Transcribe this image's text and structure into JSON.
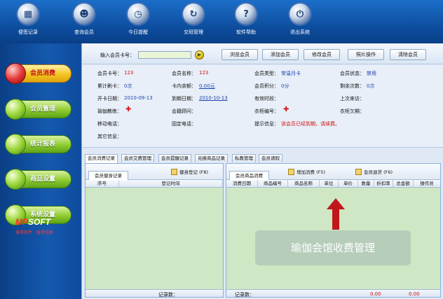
{
  "toolbar": {
    "items": [
      {
        "label": "便签记录",
        "icon": "notepad-icon"
      },
      {
        "label": "查询会员",
        "icon": "member-search-icon"
      },
      {
        "label": "今日提醒",
        "icon": "clock-icon"
      },
      {
        "label": "交班管理",
        "icon": "refresh-icon"
      },
      {
        "label": "软件帮助",
        "icon": "help-icon"
      },
      {
        "label": "退出系统",
        "icon": "power-icon"
      }
    ]
  },
  "nav": {
    "items": [
      {
        "label": "会员消费",
        "active": true
      },
      {
        "label": "会员管理",
        "active": false
      },
      {
        "label": "统计报表",
        "active": false
      },
      {
        "label": "商品设置",
        "active": false
      },
      {
        "label": "系统设置",
        "active": false
      }
    ]
  },
  "logo": {
    "brand_a": "MP",
    "brand_b": "SOFT",
    "tagline": "美萍软件 · 值得信赖"
  },
  "search": {
    "card_label": "输入会员卡号：",
    "card_value": "",
    "buttons": [
      "浏览会员",
      "添加会员",
      "修改会员",
      "照片操作",
      "清除会员"
    ]
  },
  "member": {
    "card_no_label": "会员卡号：",
    "card_no": "123",
    "name_label": "会员名称：",
    "name": "123",
    "type_label": "会员类型：",
    "type": "常温月卡",
    "status_label": "会员状态：",
    "status": "禁用",
    "total_label": "累计刷卡：",
    "total": "0次",
    "balance_label": "卡内余额：",
    "balance": "0.00元",
    "points_label": "会员积分：",
    "points": "0分",
    "remaining_label": "剩余次数：",
    "remaining": "0次",
    "open_date_label": "开卡日期：",
    "open_date": "2010-09-13",
    "expire_label": "到期日期：",
    "expire": "2010-10-13",
    "valid_label": "有效时段：",
    "valid": "",
    "last_visit_label": "上次来访：",
    "last_visit": "",
    "coach_label": "瑜伽教练：",
    "consultant_label": "会籍顾问：",
    "locker_label": "衣柜编号：",
    "locker_expire_label": "衣柜欠期：",
    "mobile_label": "移动电话：",
    "phone_label": "固定电话：",
    "hint_label": "提示信息：",
    "hint": "该会员已经到期，请续费。",
    "other_label": "其它信息："
  },
  "tabs": [
    "会员消费记录",
    "会员交费管理",
    "会员提醒记录",
    "兑换商品记录",
    "私教管理",
    "会员请假"
  ],
  "left_panel": {
    "tab": "会员健身记录",
    "action": "健身登记 (F8)",
    "columns": [
      "序号",
      "登记时间"
    ],
    "footer_label": "记录数："
  },
  "right_panel": {
    "tab": "会员商品消费",
    "action_add": "增加消费 (F5)",
    "action_return": "会员退货 (F6)",
    "columns": [
      "消费日期",
      "商品编号",
      "商品名称",
      "单位",
      "单价",
      "数量",
      "折扣率",
      "总金额",
      "操作员"
    ],
    "footer_label": "记录数：",
    "footer_values": [
      "0.00",
      "0.00"
    ]
  },
  "overlay_text": "瑜伽会馆收费管理",
  "colors": {
    "accent_red": "#d01010",
    "link_blue": "#1d3fb0",
    "nav_green": "#8fcc2e",
    "nav_active": "#f5c422"
  }
}
